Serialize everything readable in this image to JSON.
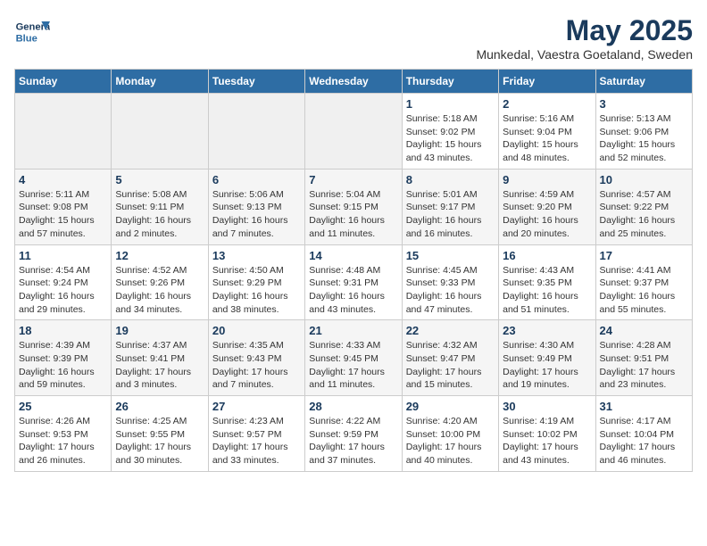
{
  "logo": {
    "line1": "General",
    "line2": "Blue"
  },
  "title": "May 2025",
  "location": "Munkedal, Vaestra Goetaland, Sweden",
  "days_of_week": [
    "Sunday",
    "Monday",
    "Tuesday",
    "Wednesday",
    "Thursday",
    "Friday",
    "Saturday"
  ],
  "weeks": [
    [
      {
        "num": "",
        "info": ""
      },
      {
        "num": "",
        "info": ""
      },
      {
        "num": "",
        "info": ""
      },
      {
        "num": "",
        "info": ""
      },
      {
        "num": "1",
        "info": "Sunrise: 5:18 AM\nSunset: 9:02 PM\nDaylight: 15 hours\nand 43 minutes."
      },
      {
        "num": "2",
        "info": "Sunrise: 5:16 AM\nSunset: 9:04 PM\nDaylight: 15 hours\nand 48 minutes."
      },
      {
        "num": "3",
        "info": "Sunrise: 5:13 AM\nSunset: 9:06 PM\nDaylight: 15 hours\nand 52 minutes."
      }
    ],
    [
      {
        "num": "4",
        "info": "Sunrise: 5:11 AM\nSunset: 9:08 PM\nDaylight: 15 hours\nand 57 minutes."
      },
      {
        "num": "5",
        "info": "Sunrise: 5:08 AM\nSunset: 9:11 PM\nDaylight: 16 hours\nand 2 minutes."
      },
      {
        "num": "6",
        "info": "Sunrise: 5:06 AM\nSunset: 9:13 PM\nDaylight: 16 hours\nand 7 minutes."
      },
      {
        "num": "7",
        "info": "Sunrise: 5:04 AM\nSunset: 9:15 PM\nDaylight: 16 hours\nand 11 minutes."
      },
      {
        "num": "8",
        "info": "Sunrise: 5:01 AM\nSunset: 9:17 PM\nDaylight: 16 hours\nand 16 minutes."
      },
      {
        "num": "9",
        "info": "Sunrise: 4:59 AM\nSunset: 9:20 PM\nDaylight: 16 hours\nand 20 minutes."
      },
      {
        "num": "10",
        "info": "Sunrise: 4:57 AM\nSunset: 9:22 PM\nDaylight: 16 hours\nand 25 minutes."
      }
    ],
    [
      {
        "num": "11",
        "info": "Sunrise: 4:54 AM\nSunset: 9:24 PM\nDaylight: 16 hours\nand 29 minutes."
      },
      {
        "num": "12",
        "info": "Sunrise: 4:52 AM\nSunset: 9:26 PM\nDaylight: 16 hours\nand 34 minutes."
      },
      {
        "num": "13",
        "info": "Sunrise: 4:50 AM\nSunset: 9:29 PM\nDaylight: 16 hours\nand 38 minutes."
      },
      {
        "num": "14",
        "info": "Sunrise: 4:48 AM\nSunset: 9:31 PM\nDaylight: 16 hours\nand 43 minutes."
      },
      {
        "num": "15",
        "info": "Sunrise: 4:45 AM\nSunset: 9:33 PM\nDaylight: 16 hours\nand 47 minutes."
      },
      {
        "num": "16",
        "info": "Sunrise: 4:43 AM\nSunset: 9:35 PM\nDaylight: 16 hours\nand 51 minutes."
      },
      {
        "num": "17",
        "info": "Sunrise: 4:41 AM\nSunset: 9:37 PM\nDaylight: 16 hours\nand 55 minutes."
      }
    ],
    [
      {
        "num": "18",
        "info": "Sunrise: 4:39 AM\nSunset: 9:39 PM\nDaylight: 16 hours\nand 59 minutes."
      },
      {
        "num": "19",
        "info": "Sunrise: 4:37 AM\nSunset: 9:41 PM\nDaylight: 17 hours\nand 3 minutes."
      },
      {
        "num": "20",
        "info": "Sunrise: 4:35 AM\nSunset: 9:43 PM\nDaylight: 17 hours\nand 7 minutes."
      },
      {
        "num": "21",
        "info": "Sunrise: 4:33 AM\nSunset: 9:45 PM\nDaylight: 17 hours\nand 11 minutes."
      },
      {
        "num": "22",
        "info": "Sunrise: 4:32 AM\nSunset: 9:47 PM\nDaylight: 17 hours\nand 15 minutes."
      },
      {
        "num": "23",
        "info": "Sunrise: 4:30 AM\nSunset: 9:49 PM\nDaylight: 17 hours\nand 19 minutes."
      },
      {
        "num": "24",
        "info": "Sunrise: 4:28 AM\nSunset: 9:51 PM\nDaylight: 17 hours\nand 23 minutes."
      }
    ],
    [
      {
        "num": "25",
        "info": "Sunrise: 4:26 AM\nSunset: 9:53 PM\nDaylight: 17 hours\nand 26 minutes."
      },
      {
        "num": "26",
        "info": "Sunrise: 4:25 AM\nSunset: 9:55 PM\nDaylight: 17 hours\nand 30 minutes."
      },
      {
        "num": "27",
        "info": "Sunrise: 4:23 AM\nSunset: 9:57 PM\nDaylight: 17 hours\nand 33 minutes."
      },
      {
        "num": "28",
        "info": "Sunrise: 4:22 AM\nSunset: 9:59 PM\nDaylight: 17 hours\nand 37 minutes."
      },
      {
        "num": "29",
        "info": "Sunrise: 4:20 AM\nSunset: 10:00 PM\nDaylight: 17 hours\nand 40 minutes."
      },
      {
        "num": "30",
        "info": "Sunrise: 4:19 AM\nSunset: 10:02 PM\nDaylight: 17 hours\nand 43 minutes."
      },
      {
        "num": "31",
        "info": "Sunrise: 4:17 AM\nSunset: 10:04 PM\nDaylight: 17 hours\nand 46 minutes."
      }
    ]
  ]
}
